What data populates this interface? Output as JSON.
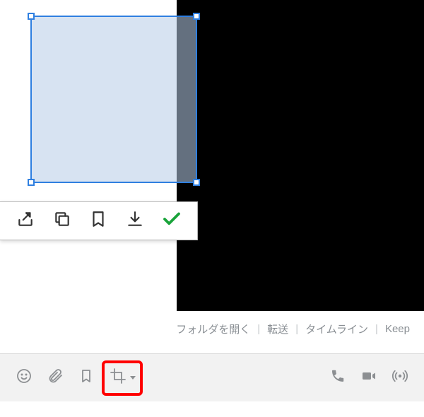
{
  "crop_toolbar": {
    "share": "share",
    "copy": "copy",
    "bookmark": "bookmark",
    "download": "download",
    "confirm": "confirm"
  },
  "links": {
    "open_folder": "フォルダを開く",
    "forward": "転送",
    "timeline": "タイムライン",
    "keep": "Keep"
  },
  "bottom_bar": {
    "emoji": "emoji",
    "attach": "attach",
    "bookmark": "bookmark",
    "capture": "capture",
    "call": "call",
    "video": "video",
    "live": "live"
  }
}
